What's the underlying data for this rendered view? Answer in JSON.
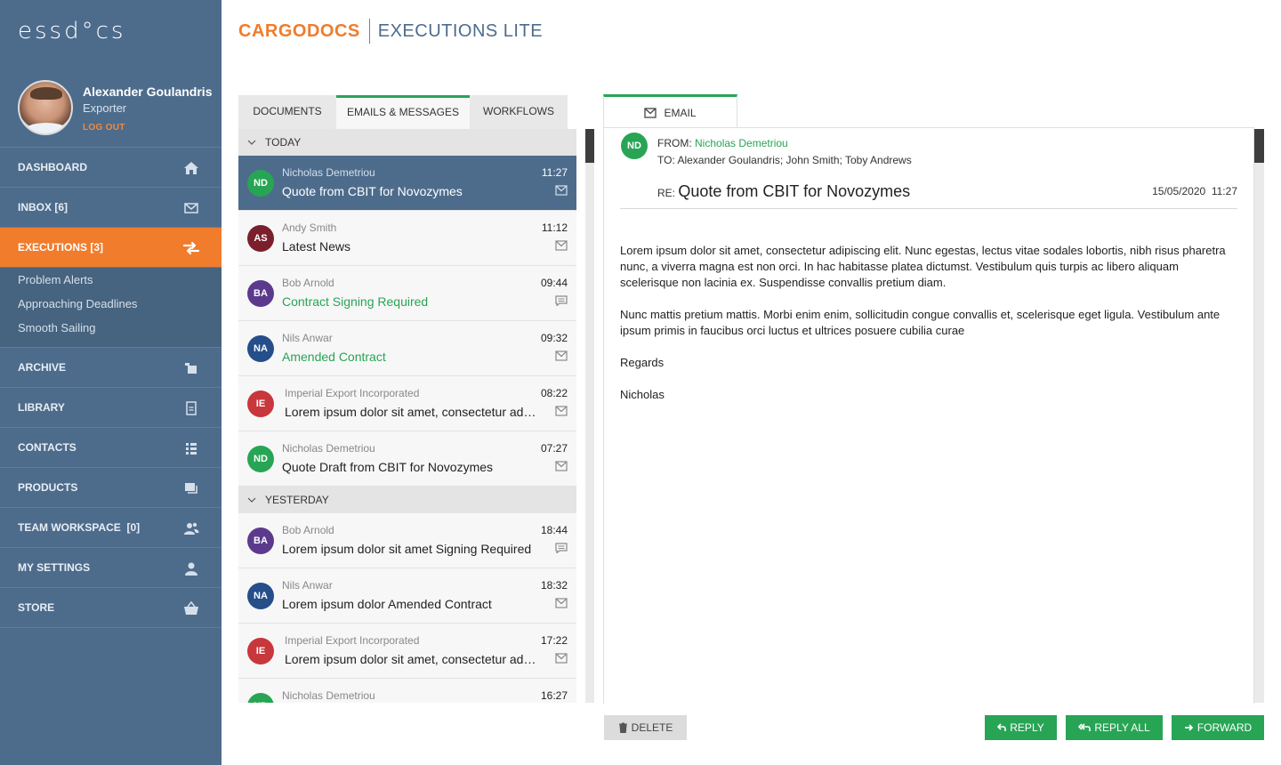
{
  "app": {
    "logo": "essd°cs",
    "brand_main": "CARGODOCS",
    "brand_sub": "EXECUTIONS LITE"
  },
  "profile": {
    "name": "Alexander Goulandris",
    "role": "Exporter",
    "logout": "LOG OUT"
  },
  "nav": {
    "dashboard": "DASHBOARD",
    "inbox": "INBOX [6]",
    "executions": "EXECUTIONS [3]",
    "sub": [
      "Problem Alerts",
      "Approaching Deadlines",
      "Smooth Sailing"
    ],
    "archive": "ARCHIVE",
    "library": "LIBRARY",
    "contacts": "CONTACTS",
    "products": "PRODUCTS",
    "team": "TEAM WORKSPACE  [0]",
    "settings": "MY SETTINGS",
    "store": "STORE"
  },
  "tabs": [
    "DOCUMENTS",
    "EMAILS & MESSAGES",
    "WORKFLOWS"
  ],
  "groups": {
    "today": "TODAY",
    "yesterday": "YESTERDAY"
  },
  "messages": [
    {
      "initials": "ND",
      "color": "#27a554",
      "sender": "Nicholas Demetriou",
      "subject": "Quote from CBIT for Novozymes",
      "time": "11:27",
      "type": "email"
    },
    {
      "initials": "AS",
      "color": "#7a1f2b",
      "sender": "Andy Smith",
      "subject": "Latest News",
      "time": "11:12",
      "type": "email"
    },
    {
      "initials": "BA",
      "color": "#5b3a8e",
      "sender": "Bob Arnold",
      "subject": "Contract Signing Required",
      "time": "09:44",
      "type": "message"
    },
    {
      "initials": "NA",
      "color": "#254e8a",
      "sender": "Nils Anwar",
      "subject": "Amended Contract",
      "time": "09:32",
      "type": "email"
    },
    {
      "initials": "IE",
      "color": "#c7373b",
      "sender": "Imperial Export Incorporated",
      "subject": "Lorem ipsum dolor sit amet, consectetur adipiscing elit",
      "time": "08:22",
      "type": "email"
    },
    {
      "initials": "ND",
      "color": "#27a554",
      "sender": "Nicholas Demetriou",
      "subject": "Quote Draft from CBIT for Novozymes",
      "time": "07:27",
      "type": "email"
    },
    {
      "initials": "BA",
      "color": "#5b3a8e",
      "sender": "Bob Arnold",
      "subject": "Lorem ipsum dolor sit amet Signing Required",
      "time": "18:44",
      "type": "message"
    },
    {
      "initials": "NA",
      "color": "#254e8a",
      "sender": "Nils Anwar",
      "subject": "Lorem ipsum dolor Amended Contract",
      "time": "18:32",
      "type": "email"
    },
    {
      "initials": "IE",
      "color": "#c7373b",
      "sender": "Imperial Export Incorporated",
      "subject": "Lorem ipsum dolor sit amet, consectetur adipiscing elit",
      "time": "17:22",
      "type": "email"
    },
    {
      "initials": "ND",
      "color": "#27a554",
      "sender": "Nicholas Demetriou",
      "subject": "",
      "time": "16:27",
      "type": "email"
    }
  ],
  "email": {
    "tab_label": "EMAIL",
    "initials": "ND",
    "from_label": "FROM:",
    "from_name": "Nicholas Demetriou",
    "to_line": "TO: Alexander Goulandris; John Smith; Toby Andrews",
    "re_label": "RE:",
    "subject": "Quote from CBIT for Novozymes",
    "date": "15/05/2020  11:27",
    "body": [
      "Lorem ipsum dolor sit amet, consectetur adipiscing elit. Nunc egestas, lectus vitae sodales lobortis, nibh risus pharetra nunc, a viverra magna est non orci. In hac habitasse platea dictumst. Vestibulum quis turpis ac libero aliquam scelerisque non lacinia ex. Suspendisse convallis pretium diam.",
      "Nunc mattis pretium mattis. Morbi enim enim, sollicitudin congue convallis et, scelerisque eget ligula. Vestibulum ante ipsum primis in faucibus orci luctus et ultrices posuere cubilia curae",
      "Regards",
      "Nicholas"
    ]
  },
  "buttons": {
    "delete": "DELETE",
    "reply": "REPLY",
    "reply_all": "REPLY ALL",
    "forward": "FORWARD"
  }
}
